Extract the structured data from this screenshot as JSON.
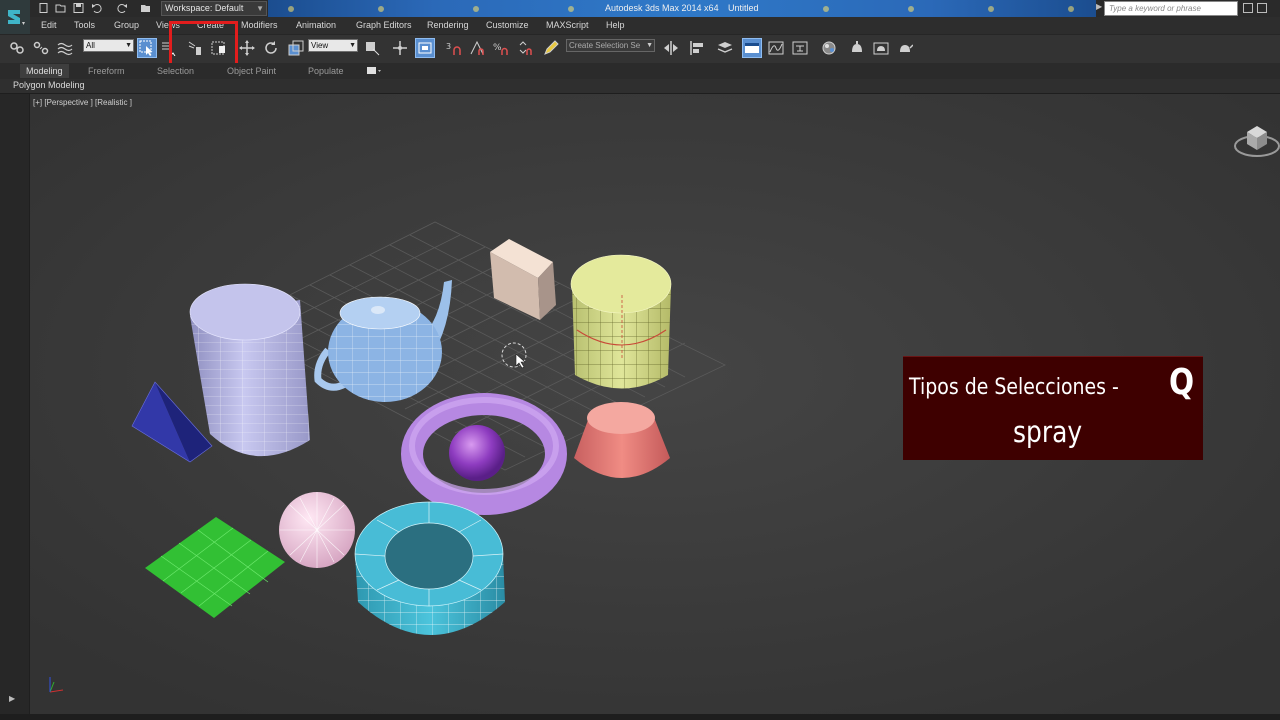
{
  "titlebar": {
    "workspace": "Workspace: Default",
    "app_title": "Autodesk 3ds Max  2014 x64",
    "doc_title": "Untitled",
    "search_placeholder": "Type a keyword or phrase"
  },
  "menu": [
    "Edit",
    "Tools",
    "Group",
    "Views",
    "Create",
    "Modifiers",
    "Animation",
    "Graph Editors",
    "Rendering",
    "Customize",
    "MAXScript",
    "Help"
  ],
  "toolbar": {
    "selection_filter": "All",
    "reference_coord": "View",
    "named_selection": "Create Selection Se"
  },
  "ribbon": {
    "tabs": [
      "Modeling",
      "Freeform",
      "Selection",
      "Object Paint",
      "Populate"
    ],
    "active_tab": "Modeling",
    "panel": "Polygon Modeling"
  },
  "viewport": {
    "label": "[+] [Perspective ] [Realistic ]",
    "objects": [
      "pyramid",
      "cylinder",
      "teapot",
      "box",
      "cylinder-yellow",
      "torus",
      "sphere",
      "cone",
      "plane",
      "geosphere",
      "tube"
    ]
  },
  "caption": {
    "line1": "Tipos de Selecciones  -",
    "letter": "Q",
    "line2": "spray",
    "background_color": "#3e0000"
  },
  "colors": {
    "title_strip": "#2b69b8",
    "active_tool": "#5a8fd0",
    "highlight": "#e21d1d",
    "viewport_bg": "#3d3d3d"
  }
}
